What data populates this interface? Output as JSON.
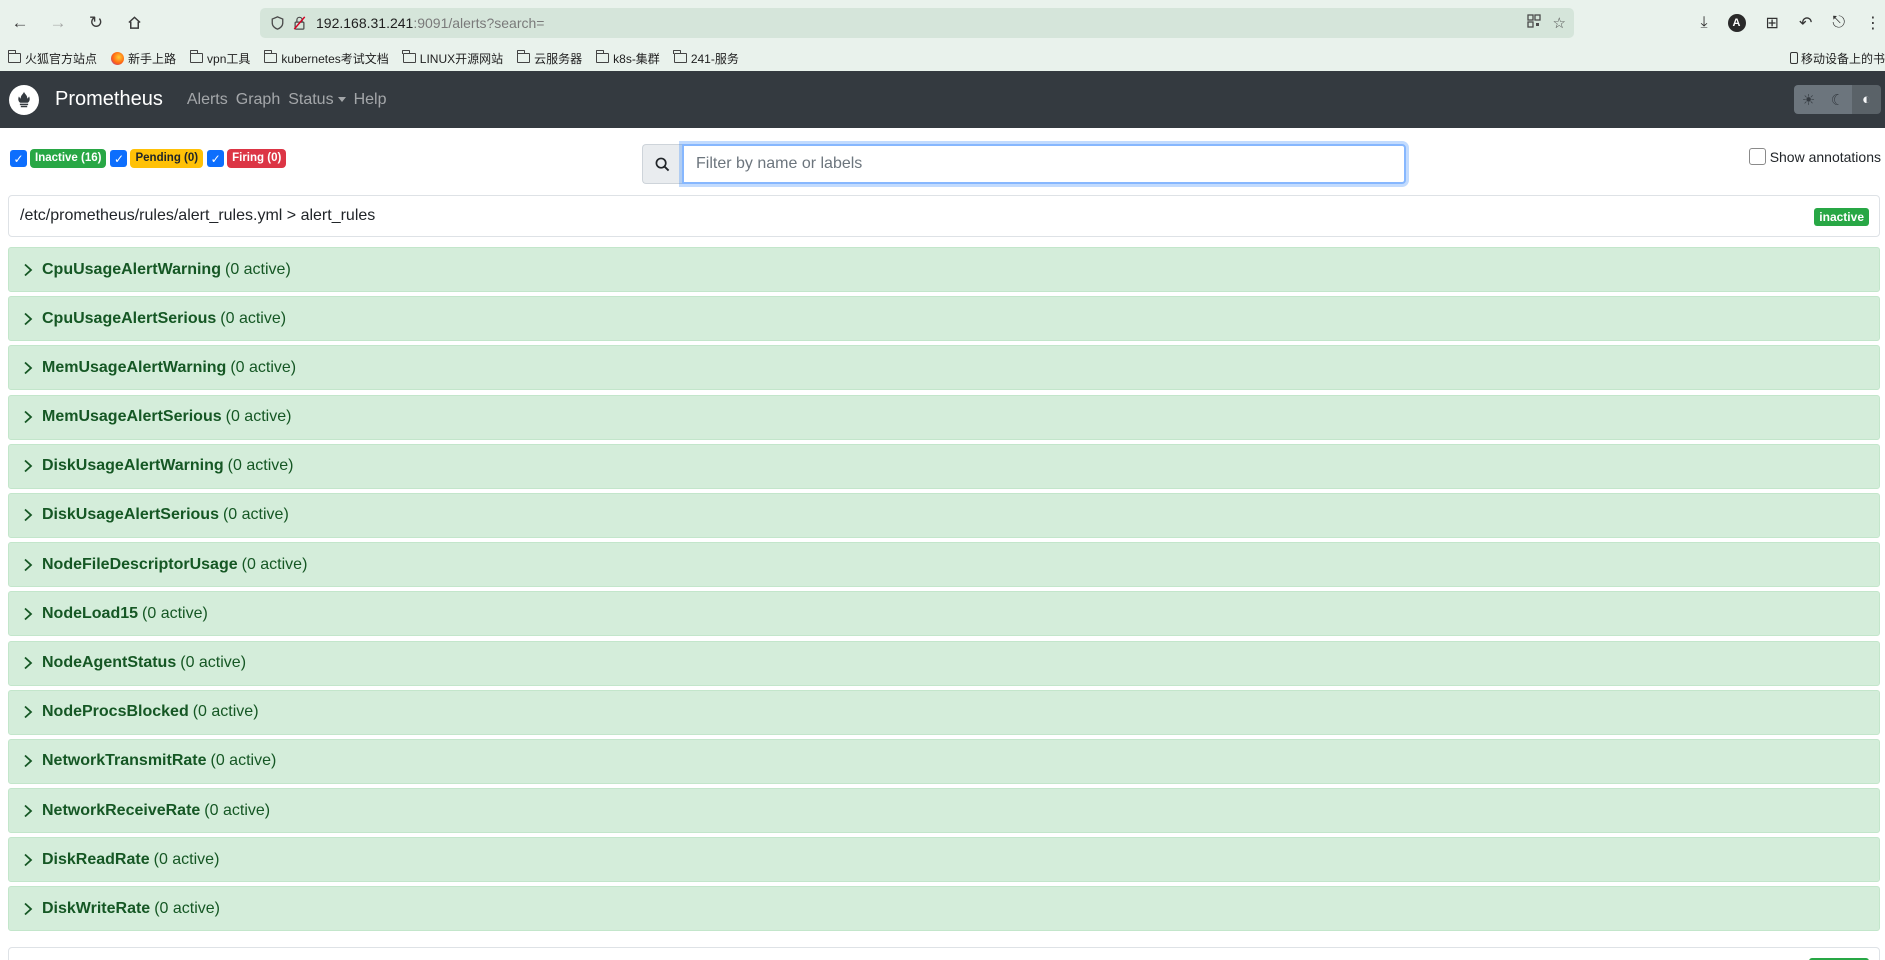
{
  "browser": {
    "url_host": "192.168.31.241",
    "url_path": ":9091/alerts?search=",
    "bookmarks": [
      {
        "label": "火狐官方站点",
        "type": "folder"
      },
      {
        "label": "新手上路",
        "type": "firefox"
      },
      {
        "label": "vpn工具",
        "type": "folder"
      },
      {
        "label": "kubernetes考试文档",
        "type": "folder"
      },
      {
        "label": "LINUX开源网站",
        "type": "folder"
      },
      {
        "label": "云服务器",
        "type": "folder"
      },
      {
        "label": "k8s-集群",
        "type": "folder"
      },
      {
        "label": "241-服务",
        "type": "folder"
      }
    ],
    "mobile_bookmarks": "移动设备上的书"
  },
  "navbar": {
    "brand": "Prometheus",
    "links": {
      "alerts": "Alerts",
      "graph": "Graph",
      "status": "Status",
      "help": "Help"
    }
  },
  "filters": {
    "inactive_label": "Inactive (16)",
    "pending_label": "Pending (0)",
    "firing_label": "Firing (0)",
    "search_placeholder": "Filter by name or labels",
    "show_annotations": "Show annotations"
  },
  "group": {
    "path": "/etc/prometheus/rules/alert_rules.yml > alert_rules",
    "state": "inactive"
  },
  "rules": [
    {
      "name": "CpuUsageAlertWarning",
      "count": "(0 active)"
    },
    {
      "name": "CpuUsageAlertSerious",
      "count": "(0 active)"
    },
    {
      "name": "MemUsageAlertWarning",
      "count": "(0 active)"
    },
    {
      "name": "MemUsageAlertSerious",
      "count": "(0 active)"
    },
    {
      "name": "DiskUsageAlertWarning",
      "count": "(0 active)"
    },
    {
      "name": "DiskUsageAlertSerious",
      "count": "(0 active)"
    },
    {
      "name": "NodeFileDescriptorUsage",
      "count": "(0 active)"
    },
    {
      "name": "NodeLoad15",
      "count": "(0 active)"
    },
    {
      "name": "NodeAgentStatus",
      "count": "(0 active)"
    },
    {
      "name": "NodeProcsBlocked",
      "count": "(0 active)"
    },
    {
      "name": "NetworkTransmitRate",
      "count": "(0 active)"
    },
    {
      "name": "NetworkReceiveRate",
      "count": "(0 active)"
    },
    {
      "name": "DiskReadRate",
      "count": "(0 active)"
    },
    {
      "name": "DiskWriteRate",
      "count": "(0 active)"
    }
  ],
  "colors": {
    "navbar_bg": "#343a40",
    "inactive_green": "#28a745",
    "pending_yellow": "#ffc107",
    "firing_red": "#dc3545",
    "rule_bg": "#d4edda",
    "rule_text": "#155724"
  }
}
